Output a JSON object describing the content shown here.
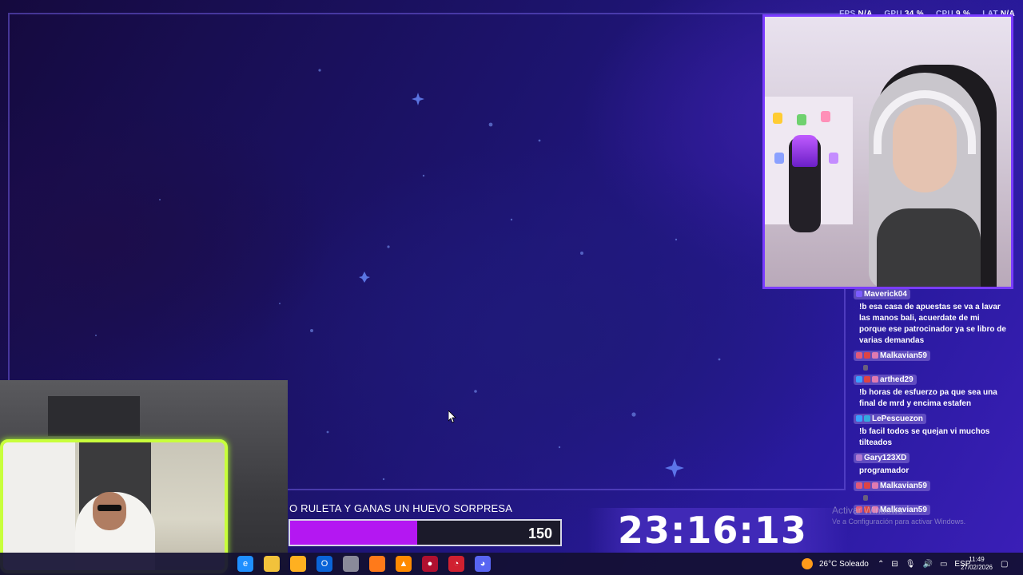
{
  "overlay": {
    "stats": [
      {
        "key": "FPS",
        "value": "N/A"
      },
      {
        "key": "GPU",
        "value": "34 %"
      },
      {
        "key": "CPU",
        "value": "9 %"
      },
      {
        "key": "LAT",
        "value": "N/A"
      }
    ],
    "goal": {
      "text": "O RULETA Y GANAS UN HUEVO SORPRESA",
      "value": "150",
      "progress_fraction": 0.47
    },
    "timer": "23:16:13"
  },
  "chat": {
    "messages": [
      {
        "user": "Maverick04",
        "text": "!b esa casa de apuestas se va a lavar las manos bali, acuerdate de mi porque ese patrocinador ya se libro de varias demandas",
        "badge_colors": [
          "#7b5cff"
        ]
      },
      {
        "user": "Malkavian59",
        "text": "",
        "badge_colors": [
          "#e05a7a",
          "#d44",
          "#e07ab0"
        ]
      },
      {
        "user": "arthed29",
        "text": "!b horas de esfuerzo pa que sea una final de mrd y encima estafen",
        "badge_colors": [
          "#3aa0ff",
          "#d44",
          "#e07ab0"
        ]
      },
      {
        "user": "LePescuezon",
        "text": "!b facil todos se quejan vi muchos tilteados",
        "badge_colors": [
          "#3aa0ff",
          "#3ad"
        ]
      },
      {
        "user": "Gary123XD",
        "text": "programador",
        "badge_colors": [
          "#b07ad0"
        ]
      },
      {
        "user": "Malkavian59",
        "text": "",
        "badge_colors": [
          "#e05a7a",
          "#d44",
          "#e07ab0"
        ]
      },
      {
        "user": "Malkavian59",
        "text": "",
        "badge_colors": [
          "#e05a7a",
          "#d44",
          "#e07ab0"
        ]
      }
    ]
  },
  "watermark": {
    "title": "Activar Windows",
    "subtitle": "Ve a Configuración para activar Windows."
  },
  "taskbar": {
    "weather": "26°C Soleado",
    "language": "ESP",
    "time": "11:49",
    "date": "27/02/2026",
    "apps": [
      {
        "name": "edge-icon",
        "color": "#1f8fff",
        "glyph": "e"
      },
      {
        "name": "file-explorer-icon",
        "color": "#f2c23b",
        "glyph": ""
      },
      {
        "name": "store-icon",
        "color": "#ffb020",
        "glyph": ""
      },
      {
        "name": "outlook-icon",
        "color": "#0a64d8",
        "glyph": "O"
      },
      {
        "name": "app-icon",
        "color": "#8a8a9a",
        "glyph": ""
      },
      {
        "name": "firefox-icon",
        "color": "#ff7a1a",
        "glyph": ""
      },
      {
        "name": "vlc-icon",
        "color": "#ff8a00",
        "glyph": "▲"
      },
      {
        "name": "obs-icon",
        "color": "#b01030",
        "glyph": "●"
      },
      {
        "name": "app-gauge-icon",
        "color": "#d02030",
        "glyph": "◔"
      },
      {
        "name": "discord-icon",
        "color": "#5865f2",
        "glyph": "◕"
      }
    ]
  }
}
